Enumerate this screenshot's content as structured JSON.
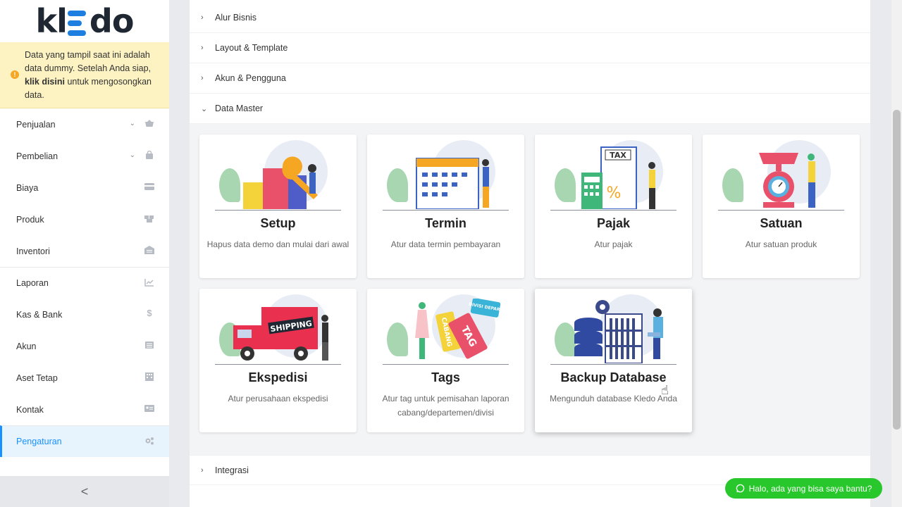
{
  "logo": {
    "left": "kl",
    "right": "do"
  },
  "notice": {
    "line1": "Data yang tampil saat ini adalah data dummy. Setelah Anda siap,",
    "link": "klik disini",
    "line2": "untuk mengosongkan data."
  },
  "menu": [
    {
      "label": "Penjualan",
      "icon": "basket-icon",
      "chevron": "chevron-down-icon"
    },
    {
      "label": "Pembelian",
      "icon": "shopping-bag-icon",
      "chevron": "chevron-down-icon"
    },
    {
      "label": "Biaya",
      "icon": "credit-card-icon"
    },
    {
      "label": "Produk",
      "icon": "boxes-icon"
    },
    {
      "label": "Inventori",
      "icon": "warehouse-icon"
    },
    {
      "label": "Laporan",
      "icon": "chart-line-icon"
    },
    {
      "label": "Kas & Bank",
      "icon": "dollar-icon"
    },
    {
      "label": "Akun",
      "icon": "list-icon"
    },
    {
      "label": "Aset Tetap",
      "icon": "building-icon"
    },
    {
      "label": "Kontak",
      "icon": "id-card-icon"
    },
    {
      "label": "Pengaturan",
      "icon": "gears-icon",
      "active": true
    }
  ],
  "collapse": "<",
  "accordion": {
    "alur": "Alur Bisnis",
    "layout": "Layout & Template",
    "akun": "Akun & Pengguna",
    "master": "Data Master",
    "integrasi": "Integrasi"
  },
  "cards": [
    {
      "title": "Setup",
      "desc": "Hapus data demo dan mulai dari awal"
    },
    {
      "title": "Termin",
      "desc": "Atur data termin pembayaran"
    },
    {
      "title": "Pajak",
      "desc": "Atur pajak"
    },
    {
      "title": "Satuan",
      "desc": "Atur satuan produk"
    },
    {
      "title": "Ekspedisi",
      "desc": "Atur perusahaan ekspedisi"
    },
    {
      "title": "Tags",
      "desc": "Atur tag untuk pemisahan laporan cabang/departemen/divisi"
    },
    {
      "title": "Backup Database",
      "desc": "Mengunduh database Kledo Anda"
    }
  ],
  "illus_text": {
    "tax": "TAX",
    "percent": "%",
    "shipping": "SHIPPING",
    "tag": "TAG",
    "cabang": "CABANG",
    "divisi": "DIVISI DEPART"
  },
  "chat": {
    "label": "Halo, ada yang bisa saya bantu?"
  },
  "colors": {
    "accent": "#1890ff",
    "chat": "#28c82d",
    "notice": "#fdf3c2"
  }
}
